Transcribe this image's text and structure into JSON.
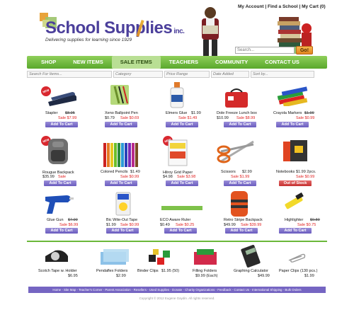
{
  "header": {
    "brand": "School Supplies",
    "brand_suffix": "inc.",
    "tagline": "Delivering supplies for learning since 1929",
    "top_links": "My Account | Find a School | My Cart (0)",
    "search_placeholder": "Search...",
    "go_label": "Go!"
  },
  "nav": [
    "SHOP",
    "NEW ITEMS",
    "SALE ITEMS",
    "TEACHERS",
    "COMMUNITY",
    "CONTACT US"
  ],
  "filters": [
    "Search For Items...",
    "Category",
    "Price Range",
    "Date Added",
    "Sort by..."
  ],
  "products": [
    {
      "name": "Stapler",
      "price": "$8.95",
      "sale": "Sale $7.99",
      "btn": "Add To Cart"
    },
    {
      "name": "Xeno Ballpoint Pen",
      "price": "$0.79",
      "sale": "Sale $0.69",
      "btn": "Add To Cart"
    },
    {
      "name": "Elmers Glue",
      "price": "$1.99",
      "sale": "Sale $1.49",
      "btn": "Add To Cart"
    },
    {
      "name": "Dole Freeze Lunch box",
      "price": "$10.99",
      "sale": "Sale $8.99",
      "btn": "Add To Cart"
    },
    {
      "name": "Crayola Markers",
      "price": "$1.99",
      "sale": "Sale $0.99",
      "btn": "Add To Cart"
    },
    {
      "name": "Rougue Backpack",
      "price": "$35.99",
      "sale": "Sale",
      "btn": "Add To Cart"
    },
    {
      "name": "Colored Pencils",
      "price": "$1.49",
      "sale": "Sale $0.99",
      "btn": "Add To Cart"
    },
    {
      "name": "Hilroy Grid Paper",
      "price": "$4.98",
      "sale": "Sale $3.98",
      "btn": "Add To Cart"
    },
    {
      "name": "Scissors",
      "price": "$2.99",
      "sale": "Sale $1.99",
      "btn": "Add To Cart"
    },
    {
      "name": "Notebooks",
      "price": "$1.99 2pcs.",
      "sale": "Sale $0.99",
      "btn": "Out of Stock"
    },
    {
      "name": "Glue Gun",
      "price": "$7.99",
      "sale": "Sale $6.99",
      "btn": "Add To Cart"
    },
    {
      "name": "Bic Wite-Out Tape",
      "price": "$1.99",
      "sale": "Sale $0.99",
      "btn": "Add To Cart"
    },
    {
      "name": "ECO Aware Ruler",
      "price": "$0.49",
      "sale": "Sale $0.25",
      "btn": "Add To Cart"
    },
    {
      "name": "Retro Stripe Backpack",
      "price": "$49.99",
      "sale": "Sale $39.99",
      "btn": "Add To Cart"
    },
    {
      "name": "Highlighter",
      "price": "$0.89",
      "sale": "Sale $0.75",
      "btn": "Add To Cart"
    }
  ],
  "bottom_products": [
    {
      "name": "Scotch Tape w. Holder",
      "price": "$6.95"
    },
    {
      "name": "Pendaflex Folders",
      "price": "$2.99"
    },
    {
      "name": "Binder Clips",
      "price": "$1.95 (50)"
    },
    {
      "name": "Filling Folders",
      "price": "$9.99 (Each)"
    },
    {
      "name": "Graphing Calculator",
      "price": "$49.99"
    },
    {
      "name": "Paper Clips (130 pcs.)",
      "price": "$1.99"
    }
  ],
  "new_badge": "NEW",
  "footer_links": "Home - Site Map - Teacher's Corner - Parent Association - Resellers - Used Supplies - Donate - Charity Organizations - Feedback - Contact Us - International Shipping - Bulk Orders",
  "copyright": "Copyright © 2012 Eugene Gaydin. All rights reserved."
}
